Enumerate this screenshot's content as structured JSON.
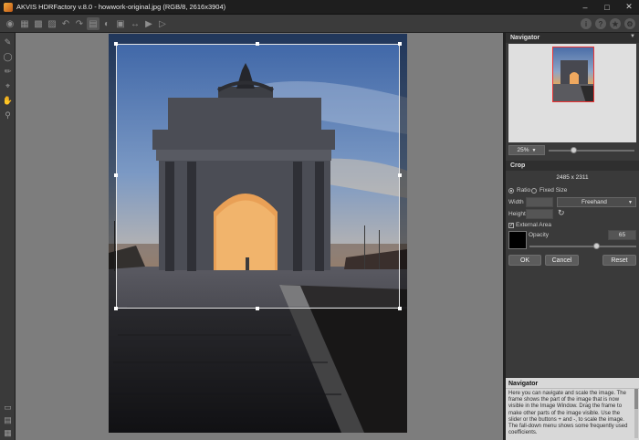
{
  "window": {
    "title": "AKVIS HDRFactory v.8.0 - howwork-original.jpg (RGB/8, 2616x3904)",
    "controls": [
      "minimize",
      "maximize",
      "close"
    ]
  },
  "toolbar": {
    "left_icons": [
      "open-icon",
      "save-icon",
      "batch-icon",
      "print-icon",
      "undo-icon",
      "redo-icon",
      "settings-icon",
      "compare-icon",
      "preview-icon",
      "back-icon",
      "forward-icon",
      "run-icon"
    ],
    "right_icons": [
      "info-icon",
      "help-icon",
      "about-icon",
      "preferences-icon"
    ],
    "right_glyphs": [
      "i",
      "?",
      "★",
      "⚙"
    ]
  },
  "left_tools": [
    "brush-icon",
    "eraser-icon",
    "history-brush-icon",
    "crop-icon",
    "hand-icon",
    "zoom-icon"
  ],
  "left_tools_bottom": [
    "layers-icon",
    "view-icon",
    "grid-icon"
  ],
  "navigator": {
    "title": "Navigator",
    "zoom": "25%",
    "zoom_slider": 0.45
  },
  "crop": {
    "title": "Crop",
    "size": "2485 x 2311",
    "mode_ratio": "Ratio",
    "mode_fixed": "Fixed Size",
    "width_label": "Width",
    "height_label": "Height",
    "width_value": "",
    "height_value": "",
    "preset": "Freehand",
    "external_area_label": "External Area",
    "external_area_checked": true,
    "opacity_label": "Opacity",
    "opacity_value": "65",
    "color": "#000000",
    "ok": "OK",
    "cancel": "Cancel",
    "reset": "Reset"
  },
  "help": {
    "title": "Navigator",
    "body": "Here you can navigate and scale the image. The frame shows the part of the image that is now visible in the Image Window. Drag the frame to make other parts of the image visible. Use the slider or the buttons + and -, to scale the image. The fall-down menu shows some frequently used coefficients."
  }
}
